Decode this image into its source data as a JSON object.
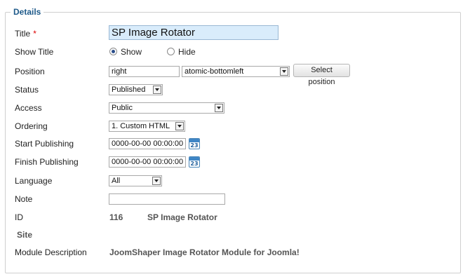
{
  "details": {
    "legend": "Details",
    "title": {
      "label": "Title",
      "required_mark": "*",
      "value": "SP Image Rotator"
    },
    "show_title": {
      "label": "Show Title",
      "options": [
        "Show",
        "Hide"
      ],
      "selected": "Show"
    },
    "position": {
      "label": "Position",
      "value": "right",
      "select_value": "atomic-bottomleft",
      "button_label": "Select position"
    },
    "status": {
      "label": "Status",
      "value": "Published"
    },
    "access": {
      "label": "Access",
      "value": "Public"
    },
    "ordering": {
      "label": "Ordering",
      "value": "1. Custom HTML"
    },
    "start_publishing": {
      "label": "Start Publishing",
      "value": "0000-00-00 00:00:00",
      "calendar_text": "23"
    },
    "finish_publishing": {
      "label": "Finish Publishing",
      "value": "0000-00-00 00:00:00",
      "calendar_text": "23"
    },
    "language": {
      "label": "Language",
      "value": "All"
    },
    "note": {
      "label": "Note",
      "value": ""
    },
    "id": {
      "label": "ID",
      "value": "116",
      "module_name": "SP Image Rotator"
    },
    "site": {
      "label": "Site"
    },
    "module_description": {
      "label": "Module Description",
      "value": "JoomShaper Image Rotator Module for Joomla!"
    }
  },
  "colors": {
    "legend": "#1e5a8a",
    "title_input_bg": "#d9ecfb",
    "required": "#dd0000"
  },
  "icons": {
    "radio": "radio-icon",
    "calendar": "calendar-icon",
    "dropdown": "chevron-down-icon"
  }
}
